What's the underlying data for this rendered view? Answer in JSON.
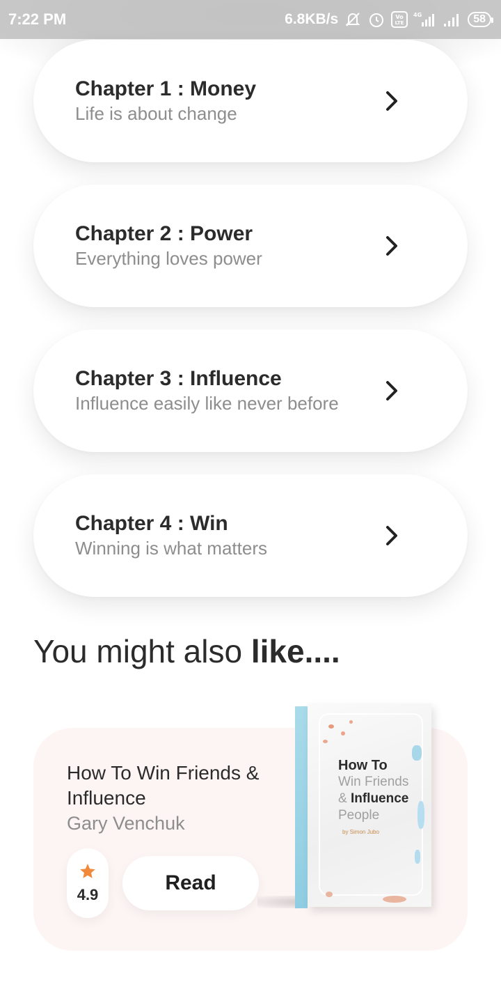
{
  "status_bar": {
    "time": "7:22 PM",
    "network_speed": "6.8KB/s",
    "icons": [
      "mute-bell-icon",
      "alarm-icon",
      "volte-icon",
      "signal-4g-icon",
      "signal-icon"
    ],
    "battery": "58",
    "volte_label": "Vo LTE",
    "network_type": "4G"
  },
  "chapters": [
    {
      "title": "Chapter 1 : Money",
      "subtitle": "Life is about change"
    },
    {
      "title": "Chapter 2 : Power",
      "subtitle": "Everything loves power"
    },
    {
      "title": "Chapter 3 : Influence",
      "subtitle": "Influence easily like never before"
    },
    {
      "title": "Chapter 4 : Win",
      "subtitle": "Winning is what matters"
    }
  ],
  "section": {
    "heading_regular": "You might also ",
    "heading_bold": "like...."
  },
  "recommendation": {
    "title": "How To Win Friends & Influence",
    "author": "Gary Venchuk",
    "rating": "4.9",
    "read_label": "Read",
    "cover": {
      "line1": "How To",
      "line2": "Win Friends",
      "line3_prefix": "& ",
      "line3_bold": "Influence",
      "line4": "People",
      "byline": "by Simon Jubo"
    }
  },
  "colors": {
    "background": "#ffffff",
    "card": "#ffffff",
    "rec_card": "#fdf5f4",
    "star": "#f08a3a",
    "muted_text": "#8d8d8d",
    "dark_text": "#2b2b2b"
  }
}
